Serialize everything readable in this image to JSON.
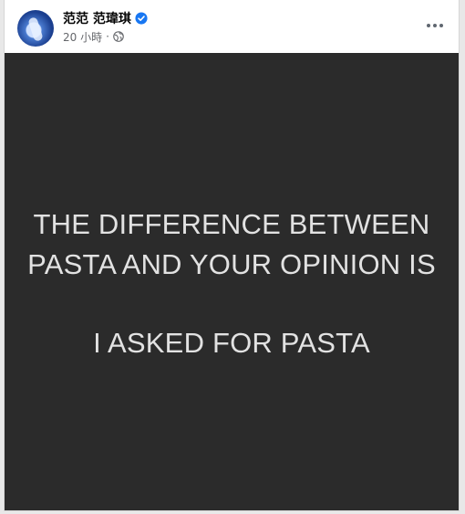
{
  "post": {
    "author_name": "范范 范瑋琪",
    "verified": true,
    "timestamp": "20 小時",
    "separator": "·",
    "audience_icon": "globe-icon",
    "more_icon": "more-options-icon",
    "image_text": {
      "line1": "THE DIFFERENCE BETWEEN",
      "line2": "PASTA AND YOUR OPINION IS",
      "line3": "I ASKED FOR PASTA"
    }
  },
  "colors": {
    "image_background": "#2b2b2b",
    "image_text": "#e2e2e2",
    "verified_badge": "#1877f2",
    "meta_text": "#65676b"
  }
}
